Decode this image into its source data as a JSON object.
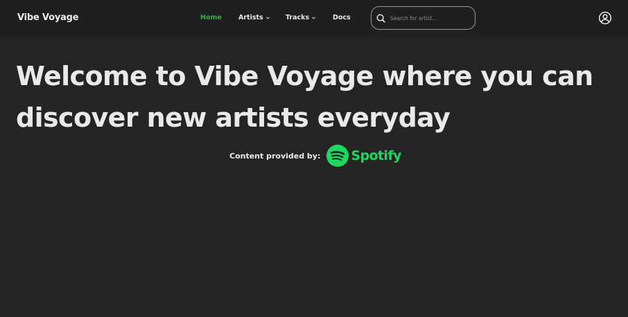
{
  "header": {
    "brand": "Vibe Voyage",
    "nav": [
      {
        "label": "Home",
        "active": true,
        "has_dropdown": false
      },
      {
        "label": "Artists",
        "active": false,
        "has_dropdown": true
      },
      {
        "label": "Tracks",
        "active": false,
        "has_dropdown": true
      },
      {
        "label": "Docs",
        "active": false,
        "has_dropdown": false
      }
    ],
    "search": {
      "placeholder": "Search for artist...",
      "value": "",
      "icon": "search-icon"
    },
    "user_icon": "user-circle-icon"
  },
  "main": {
    "title": "Welcome to Vibe Voyage where you can discover new artists everyday",
    "provided_label": "Content provided by:",
    "provider_name": "Spotify",
    "provider_icon": "spotify-icon"
  },
  "colors": {
    "background": "#242424",
    "navbar": "#1f1f1f",
    "active_nav": "#2fb34a",
    "spotify_green": "#1ed760",
    "text": "#e9e9e9"
  }
}
